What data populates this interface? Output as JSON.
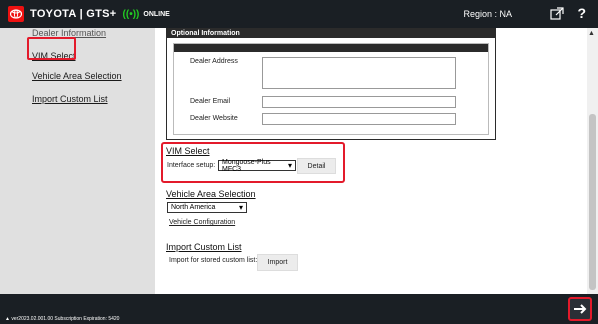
{
  "header": {
    "brand": "TOYOTA | GTS+",
    "online_label": "ONLINE",
    "region": "Region : NA"
  },
  "sidebar": {
    "items": [
      {
        "label": "Dealer Information"
      },
      {
        "label": "VIM Select"
      },
      {
        "label": "Vehicle Area Selection"
      },
      {
        "label": "Import Custom List"
      }
    ]
  },
  "optional_info": {
    "title": "Optional Information",
    "fields": {
      "dealer_address": {
        "label": "Dealer Address",
        "value": ""
      },
      "dealer_email": {
        "label": "Dealer Email",
        "value": ""
      },
      "dealer_website": {
        "label": "Dealer Website",
        "value": ""
      }
    }
  },
  "vim_select": {
    "title": "VIM Select",
    "interface_label": "Interface setup:",
    "interface_value": "Mongoose-Plus MFC3",
    "detail_button": "Detail"
  },
  "vehicle_area": {
    "title": "Vehicle Area Selection",
    "region_value": "North America",
    "config_link": "Vehicle Configuration"
  },
  "import_custom": {
    "title": "Import Custom List",
    "description": "Import for stored custom list:",
    "import_button": "Import"
  },
  "footer": {
    "version_text": "▲ ver2023.02.001.00  Subscription Expiration: 5420"
  },
  "colors": {
    "topbar": "#1a1f24",
    "highlight": "#e31a2b",
    "online": "#22cc22"
  },
  "icons": {
    "logo": "toyota-logo-icon",
    "online": "signal-icon",
    "external": "external-window-icon",
    "help": "help-icon",
    "next": "arrow-right-icon"
  }
}
